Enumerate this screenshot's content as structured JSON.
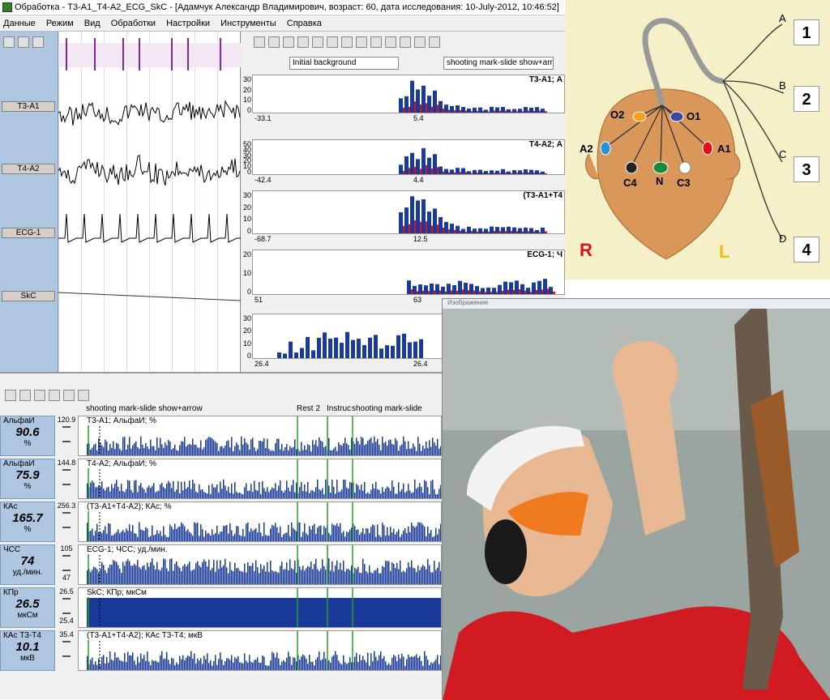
{
  "window": {
    "title": "Обработка - Т3-А1_Т4-А2_ECG_SkC - [Адамчук Александр Владимирович, возраст: 60, дата исследования: 10-July-2012, 10:46:52]"
  },
  "menu": [
    "Данные",
    "Режим",
    "Вид",
    "Обработки",
    "Настройки",
    "Инструменты",
    "Справка"
  ],
  "channels": [
    "T3-A1",
    "T4-A2",
    "ECG-1",
    "SkC"
  ],
  "hist_toolbar": {
    "background": "Initial background",
    "stimulus": "shooting mark-slide show+arr"
  },
  "histograms": [
    {
      "title": "T3-A1; А",
      "yticks": [
        "30",
        "20",
        "10",
        "0"
      ],
      "xmin": "-33.1",
      "xmid": "5.4"
    },
    {
      "title": "T4-A2; А",
      "yticks": [
        "50",
        "40",
        "30",
        "20",
        "10",
        "0"
      ],
      "xmin": "-42.4",
      "xmid": "4.4"
    },
    {
      "title": "(T3-A1+T4",
      "yticks": [
        "30",
        "20",
        "10",
        "0"
      ],
      "xmin": "-68.7",
      "xmid": "12.5"
    },
    {
      "title": "ECG-1; Ч",
      "yticks": [
        "20",
        "10",
        "0"
      ],
      "xmin": "51",
      "xmid": "63"
    },
    {
      "title": "",
      "yticks": [
        "30",
        "20",
        "10",
        "0"
      ],
      "xmin": "26.4",
      "xmid": "26.4"
    }
  ],
  "timeline": {
    "seg1": "shooting mark-slide show+arrow",
    "seg2": "Rest 2",
    "seg3": "Instruc",
    "seg4": "shooting mark-slide show"
  },
  "tracks": [
    {
      "name": "АльфаИ",
      "value": "90.6",
      "unit": "%",
      "max": "120.9",
      "min": "",
      "label": "T3-A1; АльфаИ; %"
    },
    {
      "name": "АльфаИ",
      "value": "75.9",
      "unit": "%",
      "max": "144.8",
      "min": "",
      "label": "T4-A2; АльфаИ; %"
    },
    {
      "name": "КАс",
      "value": "165.7",
      "unit": "%",
      "max": "256.3",
      "min": "",
      "label": "(T3-A1+T4-A2); КАс; %"
    },
    {
      "name": "ЧСС",
      "value": "74",
      "unit": "уд./мин.",
      "max": "105",
      "min": "47",
      "label": "ECG-1; ЧСС; уд./мин."
    },
    {
      "name": "КПр",
      "value": "26.5",
      "unit": "мкСм",
      "max": "26.5",
      "min": "25.4",
      "label": "SkC; КПр; мкСм"
    },
    {
      "name": "КАс Т3-Т4",
      "value": "10.1",
      "unit": "мкВ",
      "max": "35.4",
      "min": "",
      "label": "(T3-A1+T4-A2); КАс Т3-Т4; мкВ"
    }
  ],
  "head": {
    "electrodes": [
      "O2",
      "O1",
      "A2",
      "A1",
      "C4",
      "N",
      "C3"
    ],
    "sides": [
      "R",
      "L"
    ],
    "leads": [
      "A",
      "B",
      "C",
      "D"
    ],
    "numbers": [
      "1",
      "2",
      "3",
      "4"
    ]
  },
  "photo": {
    "caption": "Изображение"
  },
  "colors": {
    "red": "#e0101a",
    "blue": "#1a3a9a",
    "panel": "#aec6e0"
  }
}
